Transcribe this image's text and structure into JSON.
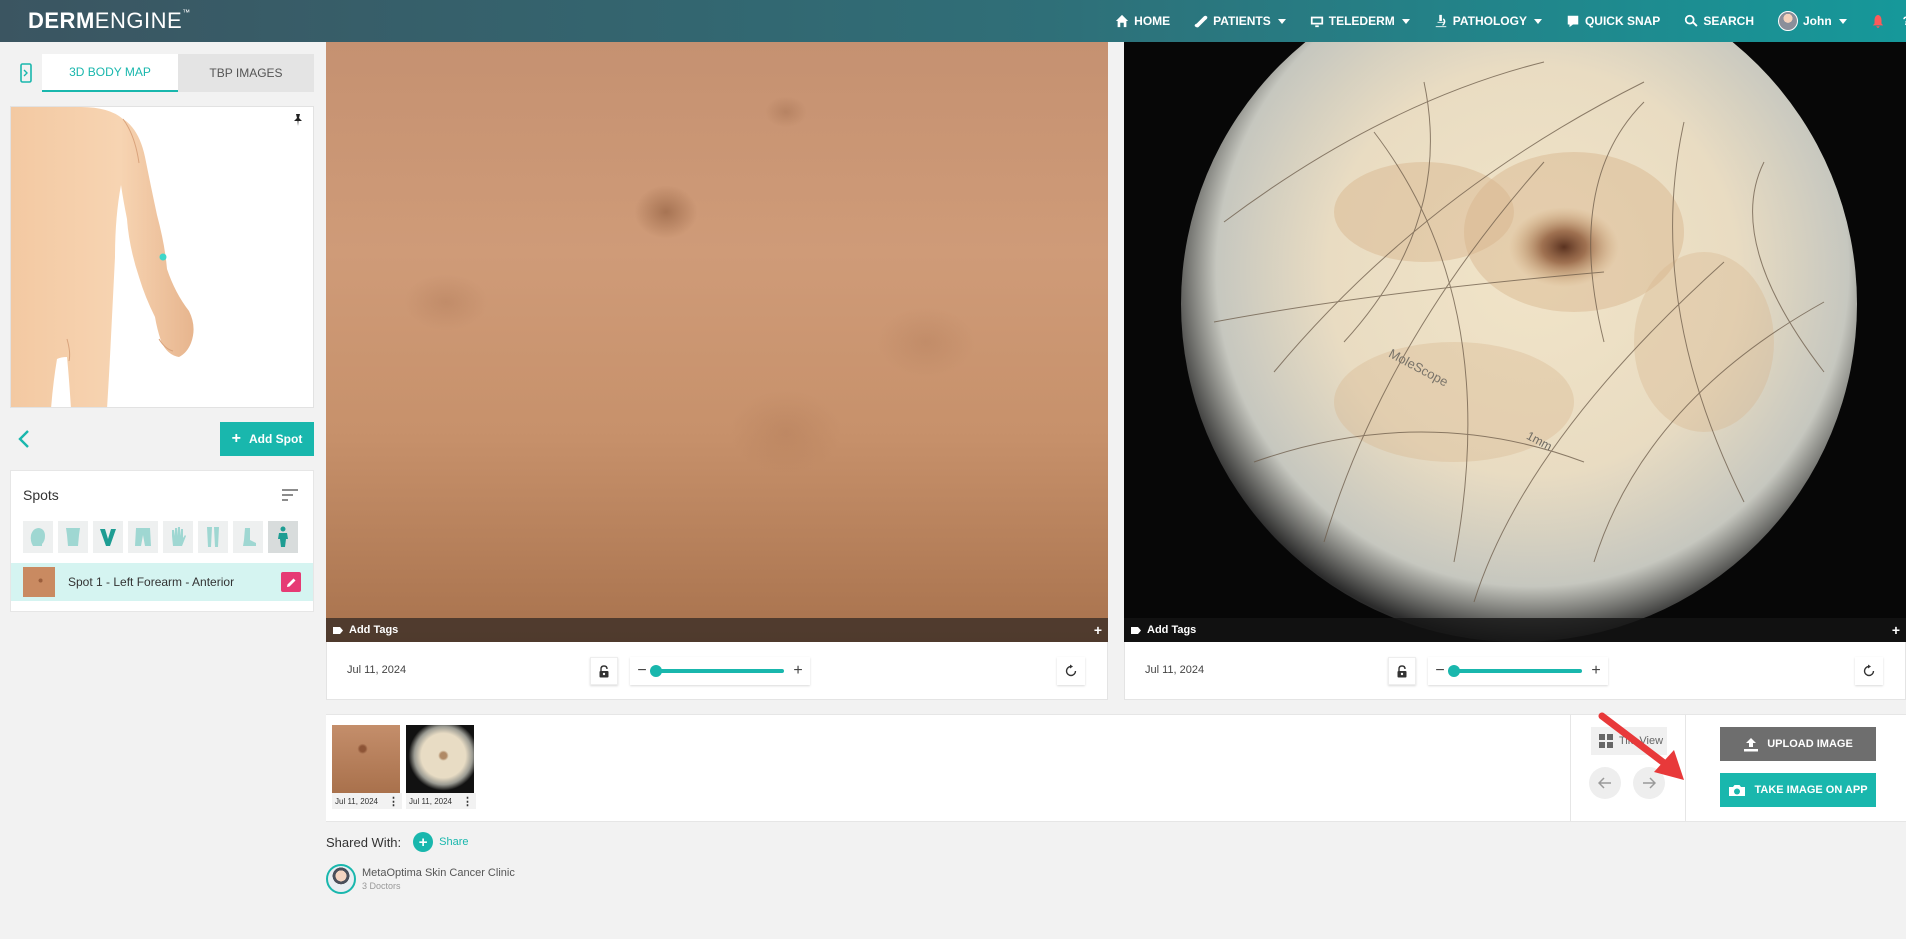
{
  "brand": {
    "bold": "DERM",
    "light": "ENGINE",
    "tm": "™"
  },
  "nav": {
    "home": "HOME",
    "patients": "PATIENTS",
    "telederm": "TELEDERM",
    "pathology": "PATHOLOGY",
    "quick_snap": "QUICK SNAP",
    "search": "SEARCH",
    "user": "John",
    "help": "?"
  },
  "left": {
    "tabs": [
      "3D BODY MAP",
      "TBP IMAGES"
    ],
    "help_icon": "?",
    "add_spot": "Add Spot",
    "spots_title": "Spots",
    "filters": [
      "head-icon",
      "torso-icon",
      "genital-icon",
      "pelvis-icon",
      "hand-icon",
      "legs-icon",
      "foot-icon",
      "full-body-icon"
    ],
    "spot": {
      "label": "Spot 1 - Left Forearm - Anterior"
    }
  },
  "viewer": {
    "panels": [
      {
        "add_tags": "Add Tags",
        "plus": "+",
        "date": "Jul 11, 2024",
        "zoom": 0
      },
      {
        "add_tags": "Add Tags",
        "plus": "+",
        "date": "Jul 11, 2024",
        "zoom": 0
      }
    ],
    "dermoscopy_watermark": "MoleScope",
    "dermoscopy_scale": "1mm"
  },
  "gallery": {
    "thumbnails": [
      {
        "date": "Jul 11, 2024"
      },
      {
        "date": "Jul 11, 2024"
      }
    ],
    "tile_view": "Tile View",
    "upload": "UPLOAD IMAGE",
    "take_image": "TAKE IMAGE ON APP"
  },
  "shared": {
    "label": "Shared With:",
    "share": "Share",
    "clinic_name": "MetaOptima Skin Cancer Clinic",
    "clinic_sub": "3 Doctors"
  },
  "colors": {
    "accent": "#19b7ad",
    "edit": "#e63a74",
    "arrow": "#e8393a"
  }
}
